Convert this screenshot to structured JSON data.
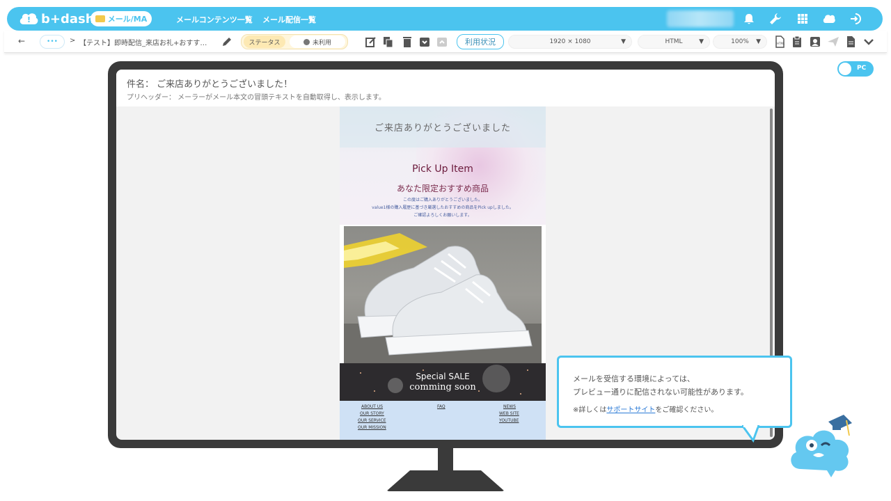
{
  "header": {
    "logo": "b+dash",
    "app_pill": "メール/MA",
    "nav": [
      "メールコンテンツ一覧",
      "メール配信一覧"
    ],
    "icons": [
      "bell-icon",
      "wrench-icon",
      "grid-icon",
      "support-icon",
      "logout-icon"
    ],
    "accent": "#4bc4ef"
  },
  "toolbar": {
    "back": "←",
    "dots": "•••",
    "sep": ">",
    "breadcrumb": "【テスト】即時配信_来店お礼+おすす…",
    "status_label": "ステータス",
    "status_value": "未利用",
    "usage_button": "利用状況",
    "resolution": "1920 × 1080",
    "format": "HTML",
    "zoom": "100%"
  },
  "preview": {
    "subject": "件名： ご来店ありがとうございました！",
    "preheader": "プリヘッダー： メーラーがメール本文の冒頭テキストを自動取得し、表示します。",
    "toggle": "PC"
  },
  "mail": {
    "hero_title": "ご来店ありがとうございました",
    "pick_title": "Pick Up Item",
    "pick_sub": "あなた限定おすすめ商品",
    "lines": [
      "この度はご購入ありがとうございました。",
      "value1様の購入履歴に基づき厳選したおすすめの商品をPick upしました。",
      "ご確認よろしくお願いします。"
    ],
    "sale1": "Special SALE",
    "sale2": "comming soon",
    "footer_col1": [
      "ABOUT US",
      "OUR STORY",
      "OUR SERVICE",
      "OUR MISSION"
    ],
    "footer_col2": [
      "FAQ"
    ],
    "footer_col3": [
      "NEWS",
      "WEB SITE",
      "YOUTUBE"
    ]
  },
  "notice": {
    "line1": "メールを受信する環境によっては、",
    "line2": "プレビュー通りに配信されない可能性があります。",
    "line3_pre": "※詳しくは",
    "line3_link": "サポートサイト",
    "line3_post": "をご確認ください。"
  }
}
